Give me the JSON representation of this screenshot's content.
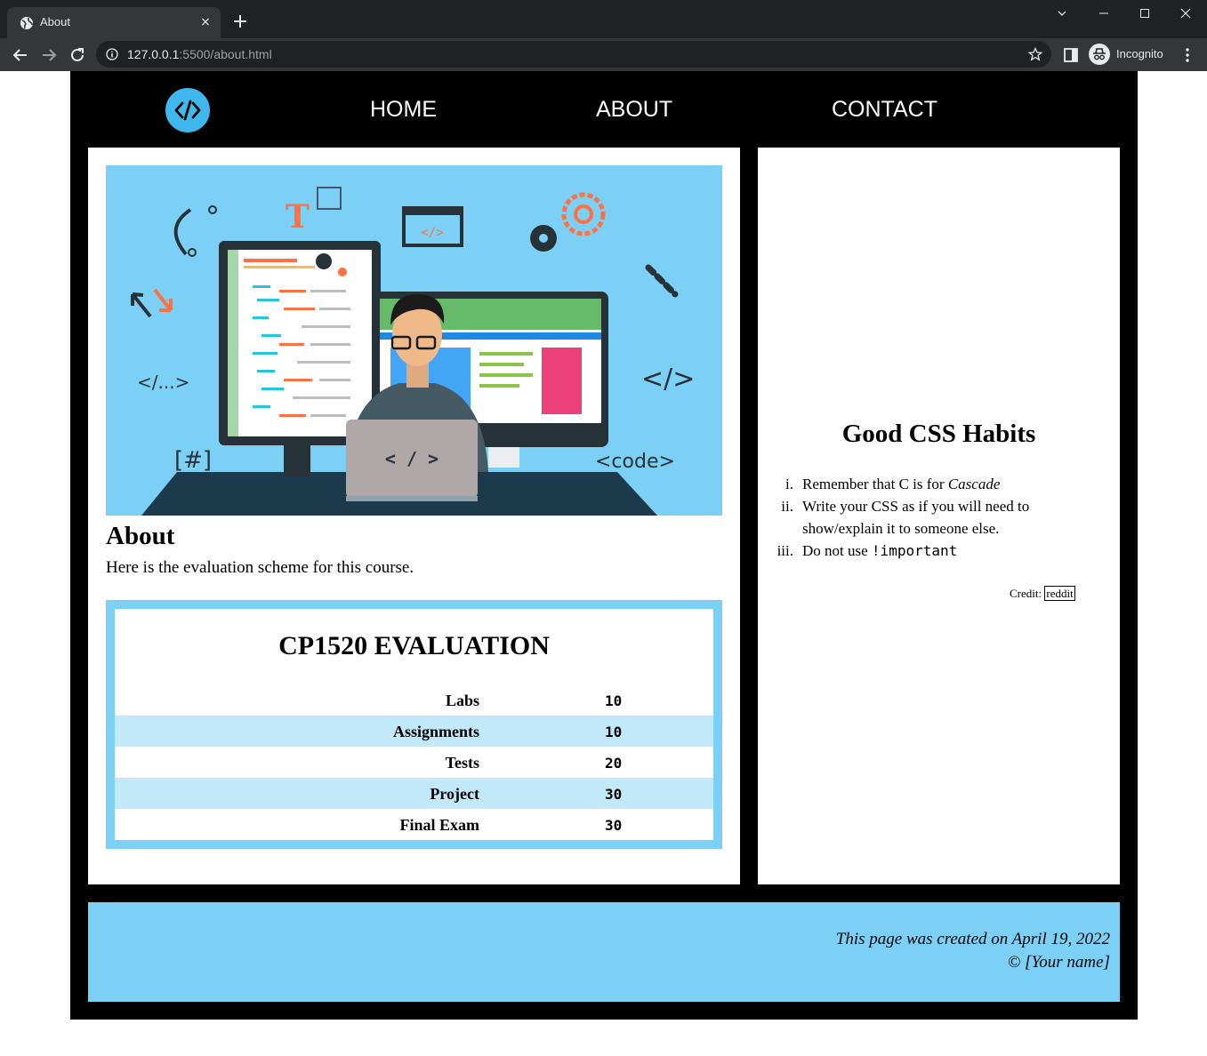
{
  "browser": {
    "tab_title": "About",
    "tab_close": "×",
    "url_host": "127.0.0.1",
    "url_rest": ":5500/about.html",
    "profile_label": "Incognito"
  },
  "nav": {
    "items": [
      "HOME",
      "ABOUT",
      "CONTACT"
    ]
  },
  "hero_image": {
    "labels": [
      "T",
      "</...>",
      "[#]",
      "</>",
      "<code>",
      "< / >",
      "</>"
    ]
  },
  "about": {
    "heading": "About",
    "intro": "Here is the evaluation scheme for this course."
  },
  "evaluation": {
    "caption": "CP1520 EVALUATION",
    "rows": [
      {
        "item": "Labs",
        "weight": "10"
      },
      {
        "item": "Assignments",
        "weight": "10"
      },
      {
        "item": "Tests",
        "weight": "20"
      },
      {
        "item": "Project",
        "weight": "30"
      },
      {
        "item": "Final Exam",
        "weight": "30"
      }
    ]
  },
  "aside": {
    "heading": "Good CSS Habits",
    "tips": [
      {
        "num": "i.",
        "text_before": "Remember that C is for ",
        "emphasis": "Cascade"
      },
      {
        "num": "ii.",
        "text": "Write your CSS as if you will need to show/explain it to someone else."
      },
      {
        "num": "iii.",
        "text_before": "Do not use ",
        "code": "!important"
      }
    ],
    "credit_label": "Credit:",
    "credit_link": "reddit"
  },
  "footer": {
    "created": "This page was created on April 19, 2022",
    "copyright": "© [Your name]"
  },
  "colors": {
    "page_bg": "#000000",
    "accent": "#7dd0f5",
    "row_alt": "#c2e9fa",
    "logo": "#40b8ee"
  }
}
